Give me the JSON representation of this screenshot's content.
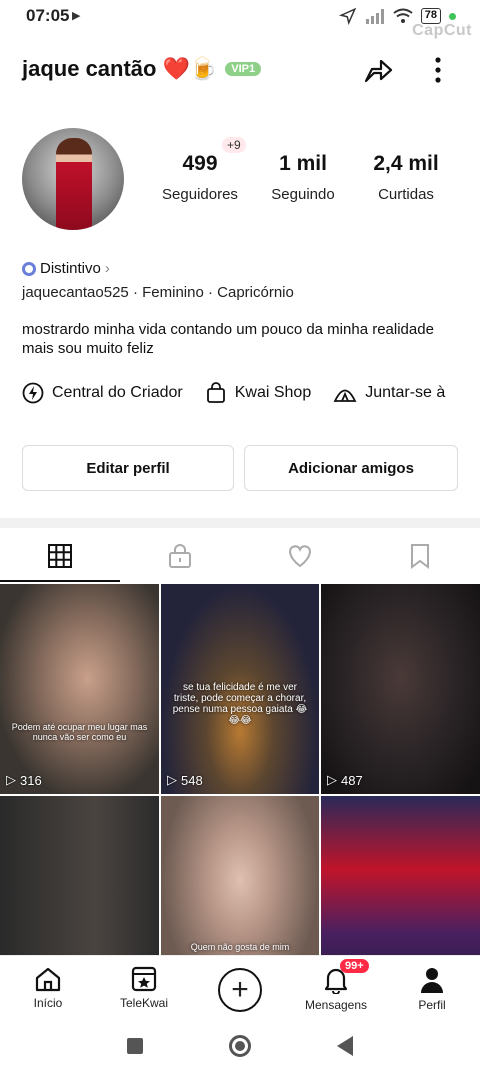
{
  "status_bar": {
    "time": "07:05",
    "battery": "78",
    "watermark": "CapCut"
  },
  "header": {
    "username": "jaque cantão",
    "emojis": "❤️🍺",
    "vip": "VIP1"
  },
  "profile": {
    "badge_new_followers": "+9",
    "stats": [
      {
        "value": "499",
        "label": "Seguidores"
      },
      {
        "value": "1 mil",
        "label": "Seguindo"
      },
      {
        "value": "2,4 mil",
        "label": "Curtidas"
      }
    ],
    "distintivo": "Distintivo",
    "handle": "jaquecantao525",
    "gender": "Feminino",
    "sign": "Capricórnio",
    "bio": "mostrardo minha vida contando um pouco da minha realidade mais sou muito feliz"
  },
  "shortcuts": [
    "Central do Criador",
    "Kwai Shop",
    "Juntar-se à"
  ],
  "buttons": {
    "edit": "Editar perfil",
    "add_friends": "Adicionar amigos"
  },
  "videos": [
    {
      "views": "316",
      "caption": "Podem até ocupar meu lugar mas nunca vão ser como eu"
    },
    {
      "views": "548",
      "caption": "se tua felicidade é me ver triste, pode começar a chorar, pense numa pessoa gaiata 😂😂😂"
    },
    {
      "views": "487",
      "caption": ""
    },
    {
      "views": "",
      "caption": ""
    },
    {
      "views": "",
      "caption": "Quem não gosta de mim"
    },
    {
      "views": "",
      "caption": ""
    }
  ],
  "bottom_nav": {
    "home": "Início",
    "telekwai": "TeleKwai",
    "messages": "Mensagens",
    "messages_badge": "99+",
    "profile": "Perfil"
  }
}
